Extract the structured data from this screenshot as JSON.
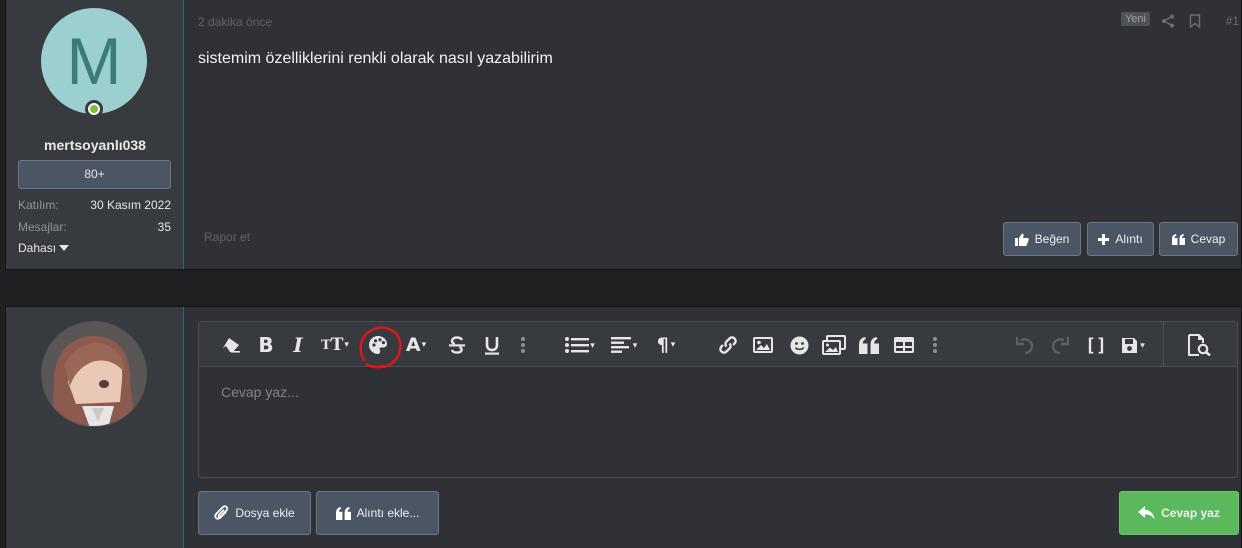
{
  "first_post": {
    "user": {
      "avatar_letter": "M",
      "username": "mertsoyanlı038",
      "rank": "80+",
      "stats": [
        {
          "key": "Katılım:",
          "value": "30 Kasım 2022"
        },
        {
          "key": "Mesajlar:",
          "value": "35"
        }
      ],
      "more_label": "Dahası"
    },
    "time": "2 dakika önce",
    "badge": "Yeni",
    "post_number": "#1",
    "message": "sistemim özelliklerini renkli olarak nasıl yazabilirim",
    "report": "Rapor et",
    "actions": {
      "like": "Beğen",
      "quote": "Alıntı",
      "reply": "Cevap"
    }
  },
  "reply_box": {
    "placeholder": "Cevap yaz...",
    "attach_label": "Dosya ekle",
    "insert_quote_label": "Alıntı ekle...",
    "submit_label": "Cevap yaz",
    "toolbar_icons": [
      "eraser-icon",
      "bold-icon",
      "italic-icon",
      "font-size-icon",
      "palette-icon",
      "font-color-icon",
      "strikethrough-icon",
      "underline-icon",
      "more-icon",
      "list-icon",
      "align-icon",
      "paragraph-icon",
      "link-icon",
      "image-icon",
      "smiley-icon",
      "media-icon",
      "quote-icon",
      "table-icon",
      "more-icon",
      "undo-icon",
      "redo-icon",
      "bbcode-icon",
      "drafts-icon",
      "preview-icon"
    ]
  },
  "colors": {
    "accent_button": "#4b5563",
    "submit_green": "#5cb85c",
    "highlight_red": "#e0161b"
  }
}
